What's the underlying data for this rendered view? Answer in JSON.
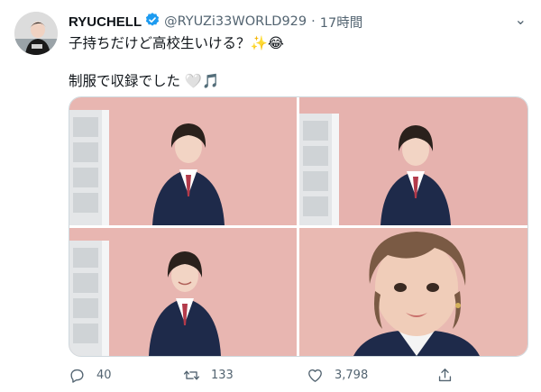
{
  "tweet": {
    "display_name": "RYUCHELL",
    "handle": "@RYUZi33WORLD929",
    "separator": "·",
    "time": "17時間",
    "more_icon": "chevron-down-icon",
    "lines": [
      "子持ちだけど高校生いける？✨😂",
      "制服で収録でした 🤍🎵"
    ],
    "verified": true
  },
  "media": {
    "photos": [
      {
        "subject": "uniform-portrait"
      },
      {
        "subject": "uniform-portrait"
      },
      {
        "subject": "uniform-portrait"
      },
      {
        "subject": "selfie-closeup"
      }
    ]
  },
  "actions": {
    "reply": {
      "icon": "reply-icon",
      "count": "40"
    },
    "retweet": {
      "icon": "retweet-icon",
      "count": "133"
    },
    "like": {
      "icon": "heart-icon",
      "count": "3,798"
    },
    "share": {
      "icon": "share-icon"
    }
  },
  "colors": {
    "accent": "#1d9bf0",
    "text": "#0f1419",
    "muted": "#536471",
    "wall": "#e8b4b0",
    "blazer": "#1e2a4a"
  }
}
